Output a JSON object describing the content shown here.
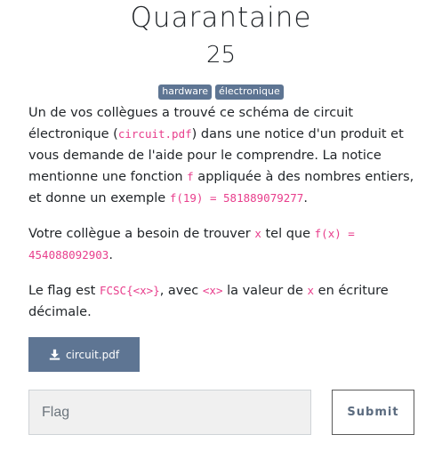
{
  "challenge": {
    "title": "Quarantaine",
    "points": "25",
    "tags": [
      "hardware",
      "électronique"
    ]
  },
  "description": {
    "p1": {
      "t1": "Un de vos collègues a trouvé ce schéma de circuit électronique (",
      "c1": "circuit.pdf",
      "t2": ") dans une notice d'un produit et vous demande de l'aide pour le comprendre. La notice mentionne une fonction ",
      "c2": "f",
      "t3": " appliquée à des nombres entiers, et donne un exemple ",
      "c3": "f(19) = 581889079277",
      "t4": "."
    },
    "p2": {
      "t1": "Votre collègue a besoin de trouver ",
      "c1": "x",
      "t2": " tel que ",
      "c2": "f(x) = 454088092903",
      "t3": "."
    },
    "p3": {
      "t1": "Le flag est ",
      "c1": "FCSC{<x>}",
      "t2": ", avec ",
      "c2": "<x>",
      "t3": " la valeur de ",
      "c3": "x",
      "t4": " en écriture décimale."
    }
  },
  "download": {
    "label": "circuit.pdf",
    "icon": "download-icon"
  },
  "form": {
    "flag_placeholder": "Flag",
    "flag_value": "",
    "submit_label": "Submit"
  },
  "colors": {
    "accent": "#5e7593",
    "code": "#e83e8c",
    "text": "#212529"
  }
}
